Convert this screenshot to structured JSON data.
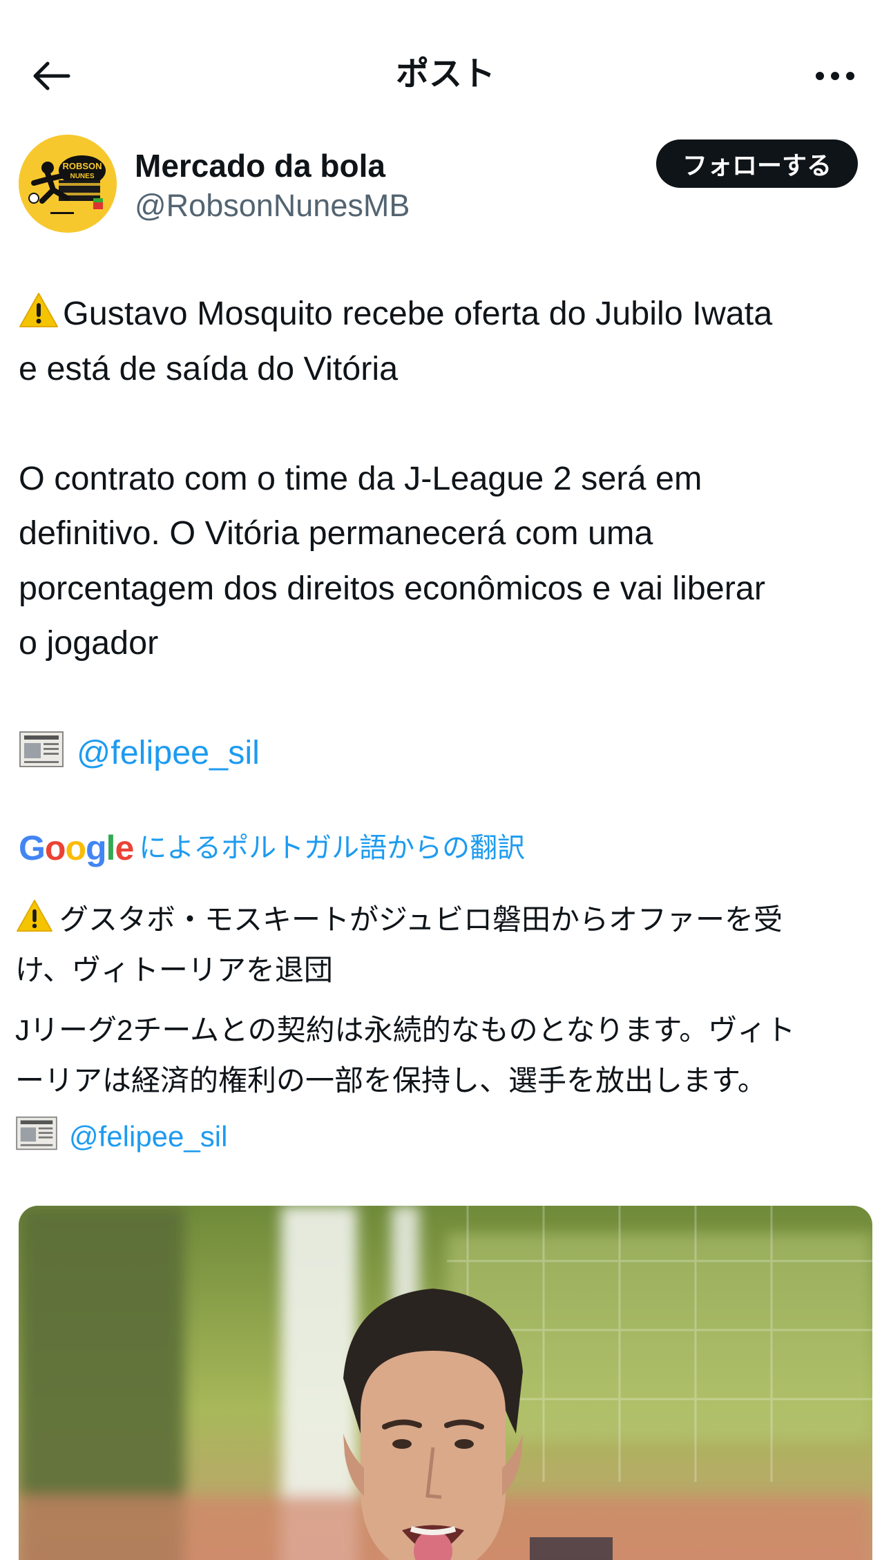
{
  "header": {
    "title": "ポスト"
  },
  "author": {
    "name": "Mercado da bola",
    "handle": "@RobsonNunesMB",
    "avatar_text_line1": "ROBSON",
    "avatar_text_line2": "NUNES",
    "follow_label": "フォローする"
  },
  "post": {
    "line1": "Gustavo Mosquito recebe oferta do Jubilo Iwata",
    "line2": "e está de saída do Vitória",
    "line3": "O contrato com o time da J-League 2 será em",
    "line4": "definitivo. O Vitória permanecerá com uma",
    "line5": "porcentagem dos direitos econômicos e vai liberar",
    "line6": "o jogador",
    "mention": "@felipee_sil"
  },
  "translation": {
    "provider": "Google",
    "label": "によるポルトガル語からの翻訳",
    "line1": "グスタボ・モスキートがジュビロ磐田からオファーを受",
    "line2": "け、ヴィトーリアを退団",
    "line3": "Jリーグ2チームとの契約は永続的なものとなります。ヴィト",
    "line4": "ーリアは経済的権利の一部を保持し、選手を放出します。",
    "mention": "@felipee_sil"
  },
  "icons": {
    "back": "arrow-left-icon",
    "more": "more-horizontal-icon",
    "warning": "warning-emoji-icon",
    "newspaper": "newspaper-emoji-icon"
  },
  "colors": {
    "link": "#1d9bf0",
    "text": "#0f1419",
    "secondary": "#536471",
    "follow_bg": "#0f1419",
    "avatar_bg": "#f7c82e"
  }
}
